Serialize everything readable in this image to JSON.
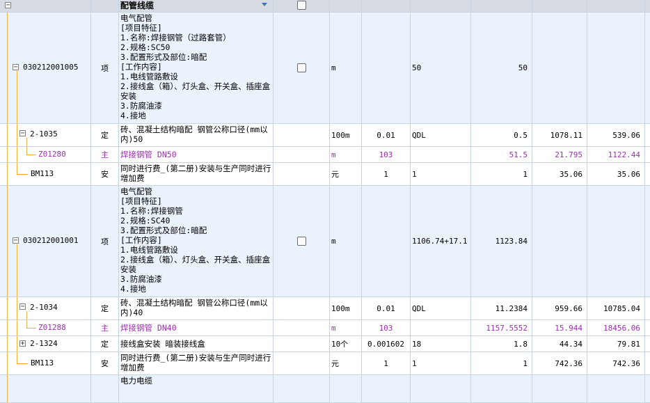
{
  "header": {
    "column_title": "配管线缆"
  },
  "rows": [
    {
      "code": "030212001005",
      "type": "项",
      "desc": "电气配管\n[项目特征]\n1.名称:焊接钢管（过路套管）\n2.规格:SC50\n3.配置形式及部位:暗配\n[工作内容]\n1.电线管路敷设\n2.接线盒（箱）、灯头盒、开关盒、插座盒安装\n3.防腐油漆\n4.接地",
      "unit": "m",
      "content": "",
      "expr": "50",
      "qty": "50",
      "price": "",
      "total": ""
    },
    {
      "code": "2-1035",
      "type": "定",
      "desc": "砖、混凝土结构暗配 钢管公称口径(mm以内)50",
      "unit": "100m",
      "content": "0.01",
      "expr": "QDL",
      "qty": "0.5",
      "price": "1078.11",
      "total": "539.06"
    },
    {
      "code": "Z01280",
      "type": "主",
      "desc": "焊接钢管 DN50",
      "unit": "m",
      "content": "103",
      "expr": "",
      "qty": "51.5",
      "price": "21.795",
      "total": "1122.44"
    },
    {
      "code": "BM113",
      "type": "安",
      "desc": "同时进行费_(第二册)安装与生产同时进行增加费",
      "unit": "元",
      "content": "1",
      "expr": "1",
      "qty": "1",
      "price": "35.06",
      "total": "35.06"
    },
    {
      "code": "030212001001",
      "type": "项",
      "desc": "电气配管\n[项目特征]\n1.名称:焊接钢管\n2.规格:SC40\n3.配置形式及部位:暗配\n[工作内容]\n1.电线管路敷设\n2.接线盒（箱）、灯头盒、开关盒、插座盒安装\n3.防腐油漆\n4.接地",
      "unit": "m",
      "content": "",
      "expr": "1106.74+17.1",
      "qty": "1123.84",
      "price": "",
      "total": ""
    },
    {
      "code": "2-1034",
      "type": "定",
      "desc": "砖、混凝土结构暗配 钢管公称口径(mm以内)40",
      "unit": "100m",
      "content": "0.01",
      "expr": "QDL",
      "qty": "11.2384",
      "price": "959.66",
      "total": "10785.04"
    },
    {
      "code": "Z01288",
      "type": "主",
      "desc": "焊接钢管 DN40",
      "unit": "m",
      "content": "103",
      "expr": "",
      "qty": "1157.5552",
      "price": "15.944",
      "total": "18456.06"
    },
    {
      "code": "2-1324",
      "type": "定",
      "desc": "接线盒安装 暗装接线盒",
      "unit": "10个",
      "content": "0.001602",
      "expr": "18",
      "qty": "1.8",
      "price": "44.34",
      "total": "79.81"
    },
    {
      "code": "BM113",
      "type": "安",
      "desc": "同时进行费_(第二册)安装与生产同时进行增加费",
      "unit": "元",
      "content": "1",
      "expr": "1",
      "qty": "1",
      "price": "742.36",
      "total": "742.36"
    },
    {
      "code": "",
      "type": "",
      "desc": "电力电缆",
      "unit": "",
      "content": "",
      "expr": "",
      "qty": "",
      "price": "",
      "total": ""
    }
  ]
}
